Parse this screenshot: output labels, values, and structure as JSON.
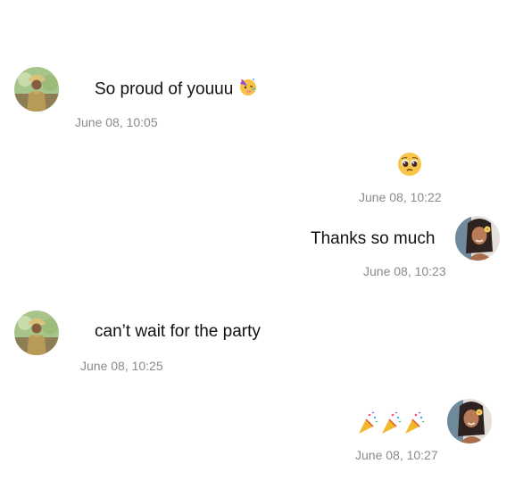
{
  "messages": [
    {
      "sender": "friend",
      "text": "So proud of youuu",
      "emoji": "partying-face",
      "timestamp": "June 08, 10:05"
    },
    {
      "sender": "me",
      "emoji": "pleading-face",
      "timestamp": "June 08, 10:22"
    },
    {
      "sender": "me",
      "text": "Thanks so much",
      "timestamp": "June 08, 10:23"
    },
    {
      "sender": "friend",
      "text": "can’t wait for the party",
      "timestamp": "June 08, 10:25"
    },
    {
      "sender": "me",
      "emoji": "party-popper-x3",
      "timestamp": "June 08, 10:27"
    }
  ]
}
